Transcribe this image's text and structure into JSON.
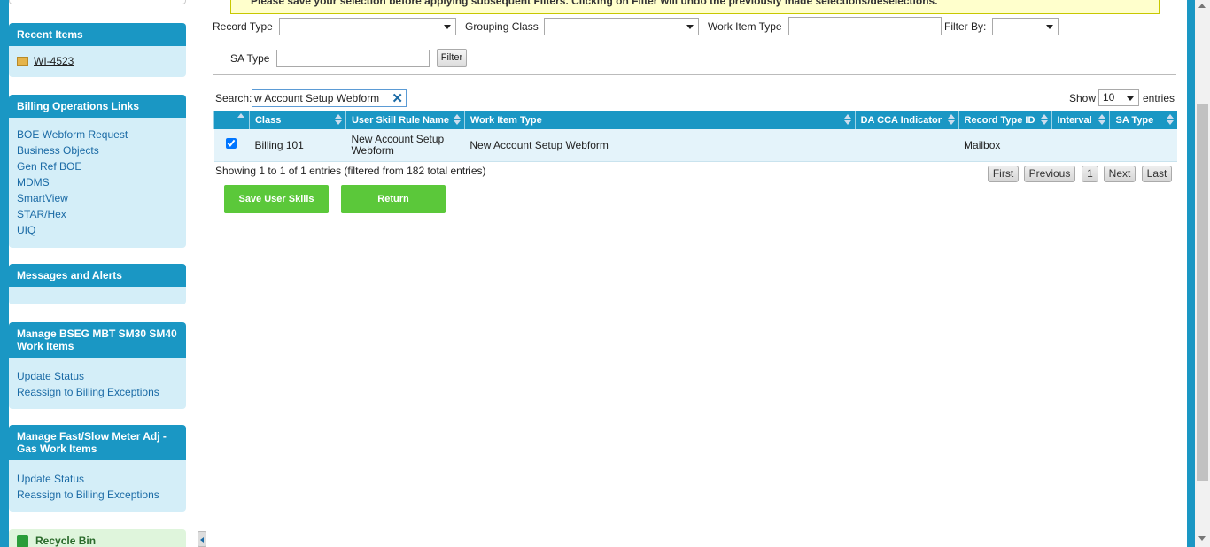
{
  "notice": "Please save your selection before applying subsequent Filters. Clicking on Filter will undo the previously made selections/deselections.",
  "sidebar": {
    "recent": {
      "title": "Recent Items",
      "items": [
        "WI-4523"
      ]
    },
    "billing_links": {
      "title": "Billing Operations Links",
      "items": [
        "BOE Webform Request",
        "Business Objects",
        "Gen Ref BOE",
        "MDMS",
        "SmartView",
        "STAR/Hex",
        "UIQ"
      ]
    },
    "messages": {
      "title": "Messages and Alerts"
    },
    "bseg": {
      "title": "Manage BSEG MBT SM30 SM40 Work Items",
      "items": [
        "Update Status",
        "Reassign to Billing Exceptions"
      ]
    },
    "fastslow": {
      "title": "Manage Fast/Slow Meter Adj - Gas Work Items",
      "items": [
        "Update Status",
        "Reassign to Billing Exceptions"
      ]
    },
    "recycle": {
      "title": "Recycle Bin"
    }
  },
  "filters": {
    "record_type_label": "Record Type",
    "grouping_class_label": "Grouping Class",
    "work_item_type_label": "Work Item Type",
    "filter_by_label": "Filter By:",
    "sa_type_label": "SA Type",
    "filter_button": "Filter"
  },
  "search": {
    "label": "Search:",
    "value": "w Account Setup Webform"
  },
  "show": {
    "label": "Show",
    "value": "10",
    "suffix": "entries"
  },
  "table": {
    "columns": [
      "Class",
      "User Skill Rule Name",
      "Work Item Type",
      "DA CCA Indicator",
      "Record Type ID",
      "Interval",
      "SA Type"
    ],
    "rows": [
      {
        "class": "Billing 101",
        "rule_name_line1": "New Account Setup",
        "rule_name_line2": "Webform",
        "work_item_type": "New Account Setup Webform",
        "da_cca": "",
        "record_type_id": "Mailbox",
        "interval": "",
        "sa_type": ""
      }
    ]
  },
  "info": "Showing 1 to 1 of 1 entries (filtered from 182 total entries)",
  "pager": {
    "first": "First",
    "previous": "Previous",
    "page": "1",
    "next": "Next",
    "last": "Last"
  },
  "actions": {
    "save": "Save User Skills",
    "return": "Return"
  }
}
